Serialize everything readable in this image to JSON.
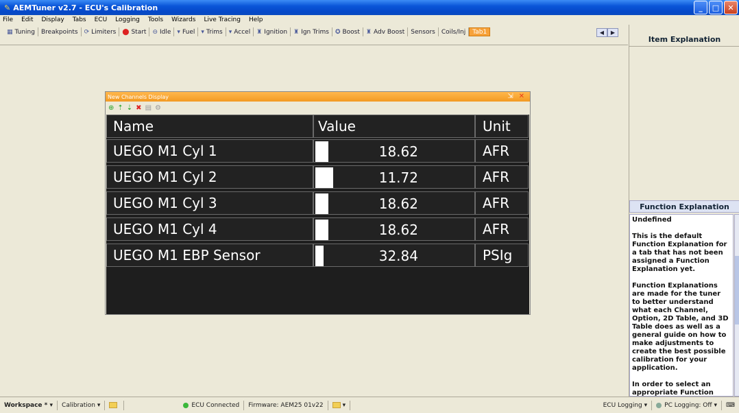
{
  "window": {
    "title": "AEMTuner v2.7 - ECU's Calibration"
  },
  "menu": [
    "File",
    "Edit",
    "Display",
    "Tabs",
    "ECU",
    "Logging",
    "Tools",
    "Wizards",
    "Live Tracing",
    "Help"
  ],
  "tabs": [
    {
      "label": "Tuning",
      "icon": "tuning-icon"
    },
    {
      "label": "Breakpoints",
      "icon": ""
    },
    {
      "label": "Limiters",
      "icon": "limiter-icon"
    },
    {
      "label": "Start",
      "icon": "start-icon"
    },
    {
      "label": "Idle",
      "icon": "idle-icon"
    },
    {
      "label": "Fuel",
      "icon": "fuel-icon"
    },
    {
      "label": "Trims",
      "icon": "trims-icon"
    },
    {
      "label": "Accel",
      "icon": "accel-icon"
    },
    {
      "label": "Ignition",
      "icon": "ignition-icon"
    },
    {
      "label": "Ign Trims",
      "icon": "ign-trims-icon"
    },
    {
      "label": "Boost",
      "icon": "boost-icon"
    },
    {
      "label": "Adv Boost",
      "icon": "adv-boost-icon"
    },
    {
      "label": "Sensors",
      "icon": ""
    },
    {
      "label": "Coils/Inj",
      "icon": ""
    },
    {
      "label": "Tab1",
      "icon": "",
      "active": true
    }
  ],
  "channels_window": {
    "title": "New Channels Display",
    "headers": {
      "name": "Name",
      "value": "Value",
      "unit": "Unit"
    },
    "rows": [
      {
        "name": "UEGO M1 Cyl 1",
        "value": "18.62",
        "unit": "AFR",
        "bar_fraction": 0.08
      },
      {
        "name": "UEGO M1 Cyl 2",
        "value": "11.72",
        "unit": "AFR",
        "bar_fraction": 0.11
      },
      {
        "name": "UEGO M1 Cyl 3",
        "value": "18.62",
        "unit": "AFR",
        "bar_fraction": 0.08
      },
      {
        "name": "UEGO M1 Cyl 4",
        "value": "18.62",
        "unit": "AFR",
        "bar_fraction": 0.08
      },
      {
        "name": "UEGO M1 EBP Sensor",
        "value": "32.84",
        "unit": "PSIg",
        "bar_fraction": 0.05
      }
    ]
  },
  "item_explanation": {
    "title": "Item Explanation"
  },
  "function_explanation": {
    "title": "Function Explanation",
    "heading": "Undefined",
    "paragraphs": [
      "This is the default Function Explanation for a tab that has not been assigned a Function Explanation yet.",
      "Function Explanations are made for the tuner to better understand what each Channel, Option, 2D Table, and 3D Table does as well as a general guide on how to make adjustments to create the best possible calibration for your application.",
      "In order to select an appropriate Function"
    ]
  },
  "status": {
    "workspace": "Workspace *",
    "calibration": "Calibration",
    "ecu_connected": "ECU Connected",
    "firmware": "Firmware: AEM25 01v22",
    "ecu_logging": "ECU Logging",
    "pc_logging": "PC Logging: Off"
  }
}
